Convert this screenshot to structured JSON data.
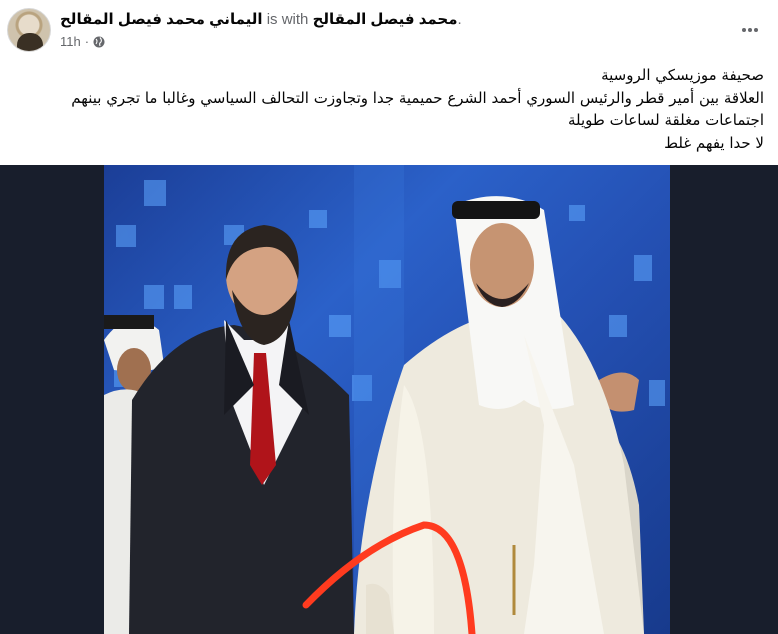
{
  "post": {
    "author": "اليماني محمد فيصل المقالح",
    "with_label": "is with",
    "tagged": "محمد فيصل المقالح",
    "end_punct": ".",
    "time": "11h",
    "sep": "·",
    "privacy_icon": "globe-icon",
    "more_icon": "more-icon"
  },
  "text": {
    "line1": "صحيفة موزيسكي الروسية",
    "line2": "العلاقة بين أمير قطر والرئيس السوري أحمد الشرع حميمية جدا وتجاوزت التحالف السياسي وغالبا ما تجري بينهم",
    "line3": "اجتماعات مغلقة لساعات طويلة",
    "line4": "لا حدا يفهم غلط"
  },
  "photo": {
    "bg_color": "#181e2c",
    "stage_color": "#2a5cc4",
    "annotation_color": "#ff3b1f"
  }
}
